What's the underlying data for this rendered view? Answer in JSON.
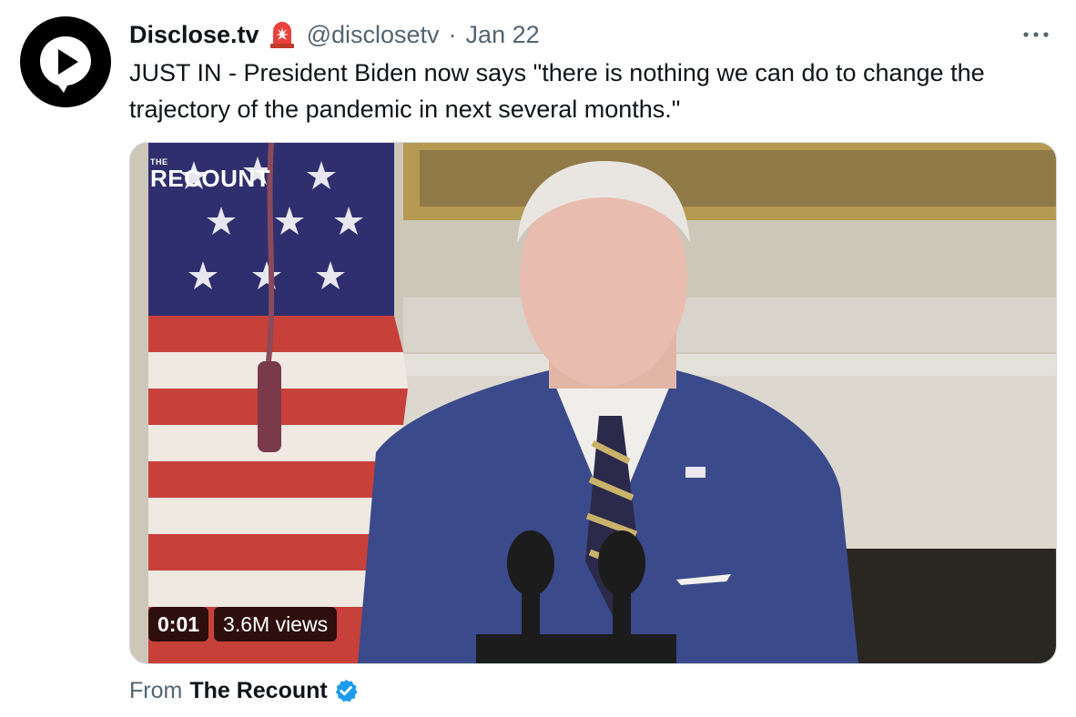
{
  "author": {
    "display_name": "Disclose.tv",
    "handle": "@disclosetv",
    "separator": "·",
    "date": "Jan 22",
    "avatar_icon": "play-speech-bubble-icon",
    "name_emoji": "police-siren-icon"
  },
  "tweet": {
    "text": "JUST IN - President Biden now says \"there is nothing we can do to change the trajectory of the pandemic in next several months.\""
  },
  "media": {
    "watermark_small": "THE",
    "watermark_large": "RECOUNT",
    "timestamp": "0:01",
    "views": "3.6M views"
  },
  "source": {
    "prefix": "From",
    "name": "The Recount",
    "verified_icon": "verified-badge-icon"
  },
  "colors": {
    "text_primary": "#0f1419",
    "text_secondary": "#536471",
    "verified_blue": "#1d9bf0",
    "border": "#cfd9de"
  }
}
